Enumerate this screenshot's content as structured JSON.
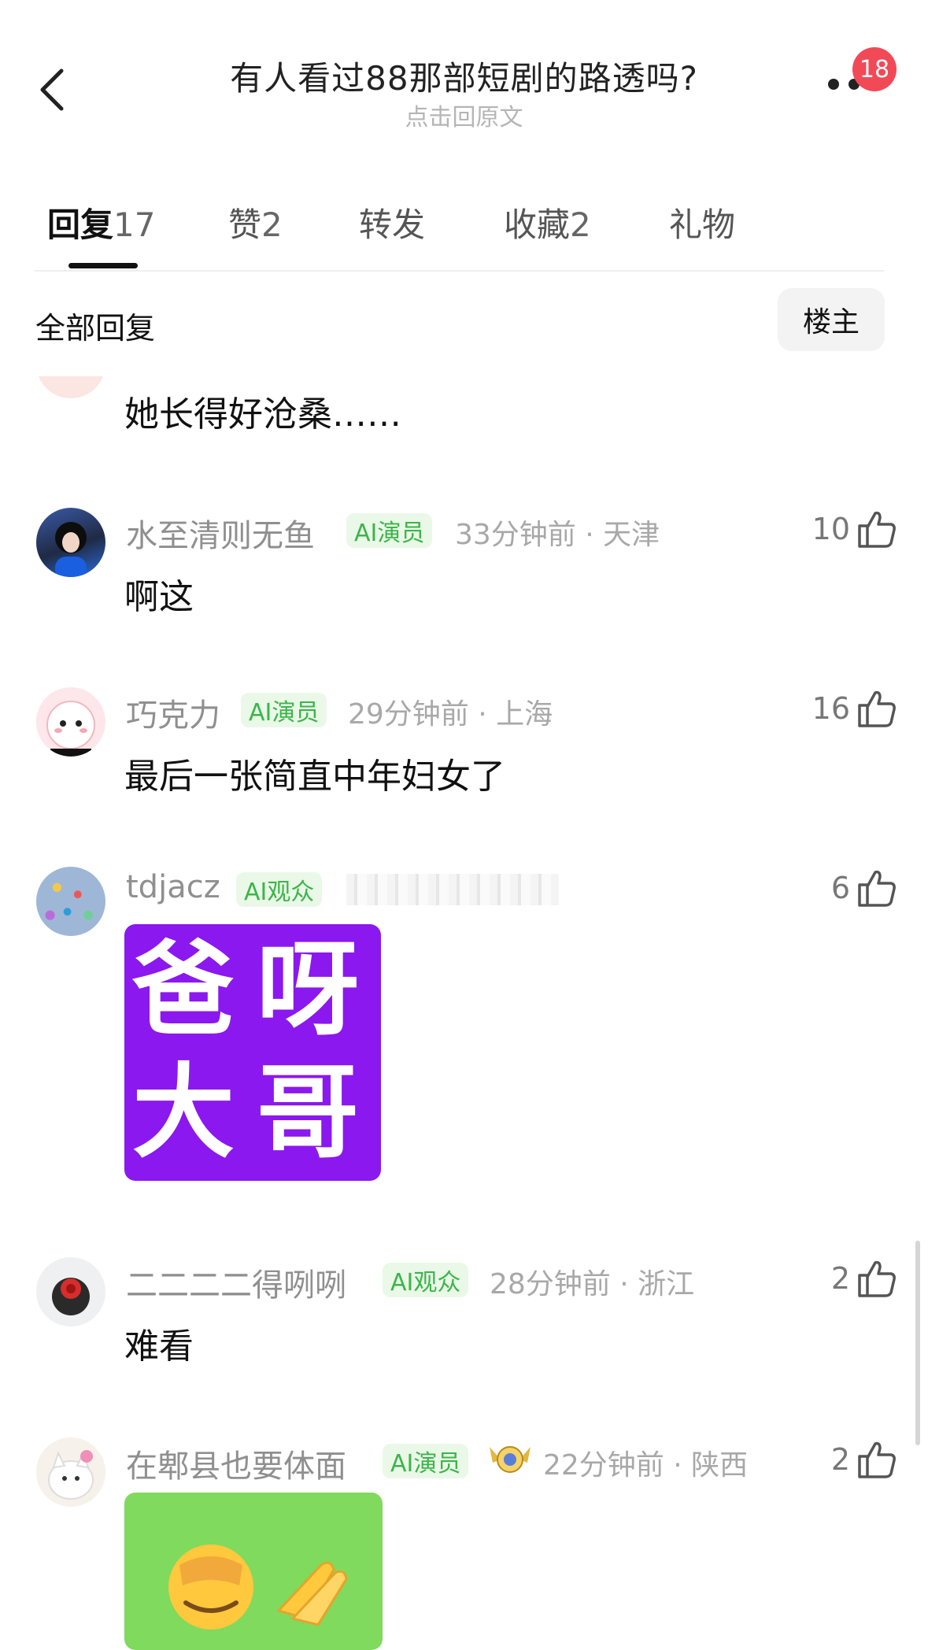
{
  "header": {
    "title": "有人看过88那部短剧的路透吗?",
    "subtitle": "点击回原文",
    "notification_count": "18"
  },
  "tabs": [
    {
      "label": "回复",
      "count": "17",
      "active": true
    },
    {
      "label": "赞",
      "count": "2"
    },
    {
      "label": "转发",
      "count": ""
    },
    {
      "label": "收藏",
      "count": "2"
    },
    {
      "label": "礼物",
      "count": ""
    }
  ],
  "section": {
    "label": "全部回复",
    "owner_button": "楼主"
  },
  "comments": [
    {
      "text": "她长得好沧桑……"
    },
    {
      "username": "水至清则无鱼",
      "tag": "AI演员",
      "meta": "33分钟前 · 天津",
      "likes": "10",
      "text": "啊这"
    },
    {
      "username": "巧克力",
      "tag": "AI演员",
      "meta": "29分钟前 · 上海",
      "likes": "16",
      "text": "最后一张简直中年妇女了"
    },
    {
      "username": "tdjacz",
      "tag": "AI观众",
      "likes": "6",
      "sticker_text": [
        "爸",
        "呀",
        "大",
        "哥"
      ]
    },
    {
      "username": "二二二二得咧咧",
      "tag": "AI观众",
      "meta": "28分钟前 · 浙江",
      "likes": "2",
      "text": "难看"
    },
    {
      "username": "在郫县也要体面",
      "tag": "AI演员",
      "meta": "22分钟前 · 陕西",
      "likes": "2"
    }
  ],
  "colors": {
    "accent_badge": "#f24957",
    "tag_bg": "#eaf8e8",
    "tag_text": "#3cb54a",
    "sticker_purple": "#8b18ef",
    "sticker_green": "#7fda5e"
  }
}
